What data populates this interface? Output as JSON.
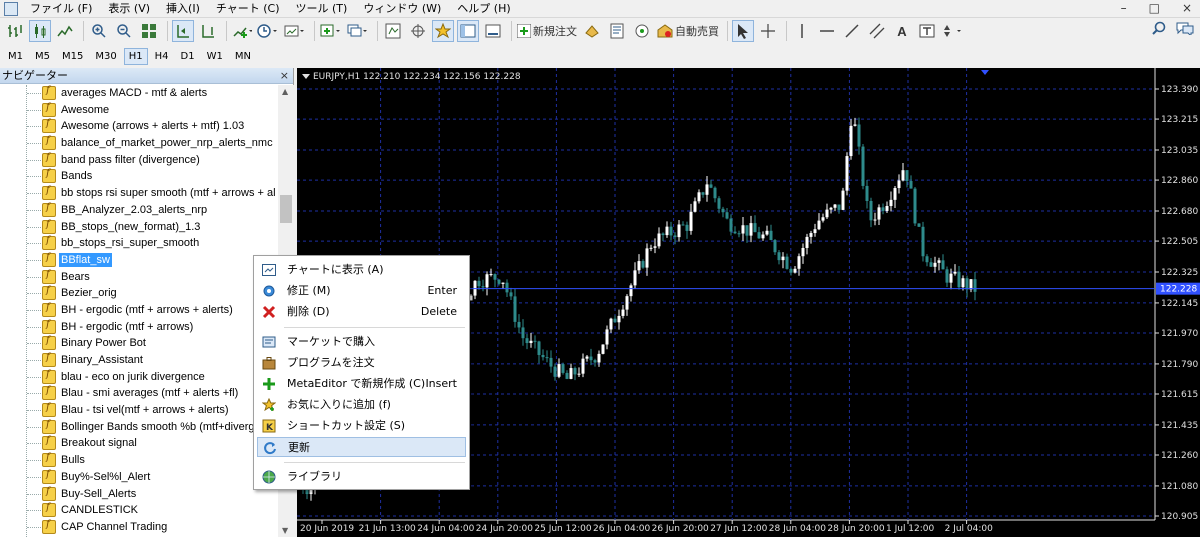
{
  "menubar": {
    "items": [
      "ファイル (F)",
      "表示 (V)",
      "挿入(I)",
      "チャート (C)",
      "ツール (T)",
      "ウィンドウ (W)",
      "ヘルプ (H)"
    ],
    "window_controls": [
      "–",
      "□",
      "×"
    ]
  },
  "toolbar": {
    "new_order_label": "新規注文",
    "auto_trade_label": "自動売買",
    "text_tool_label": "A"
  },
  "timeframes": [
    "M1",
    "M5",
    "M15",
    "M30",
    "H1",
    "H4",
    "D1",
    "W1",
    "MN"
  ],
  "active_timeframe": "H1",
  "navigator": {
    "title": "ナビゲーター",
    "close": "×",
    "items": [
      "averages MACD - mtf & alerts",
      "Awesome",
      "Awesome (arrows + alerts + mtf) 1.03",
      "balance_of_market_power_nrp_alerts_nmc",
      "band pass filter (divergence)",
      "Bands",
      "bb stops rsi super smooth (mtf + arrows + al",
      "BB_Analyzer_2.03_alerts_nrp",
      "BB_stops_(new_format)_1.3",
      "bb_stops_rsi_super_smooth",
      "BBflat_sw",
      "Bears",
      "Bezier_orig",
      "BH - ergodic (mtf + arrows + alerts)",
      "BH - ergodic (mtf + arrows)",
      "Binary Power Bot",
      "Binary_Assistant",
      "blau - eco on jurik divergence",
      "Blau - smi averages (mtf + alerts +fl)",
      "Blau - tsi vel(mtf + arrows + alerts)",
      "Bollinger Bands smooth %b (mtf+diverg",
      "Breakout signal",
      "Bulls",
      "Buy%-Sel%l_Alert",
      "Buy-Sell_Alerts",
      "CANDLESTICK",
      "CAP Channel Trading"
    ],
    "selected_index": 10
  },
  "chart": {
    "title": "EURJPY,H1  122.210 122.234 122.156 122.228",
    "price_labels": [
      "123.390",
      "123.215",
      "123.035",
      "122.860",
      "122.680",
      "122.505",
      "122.325",
      "122.145",
      "121.970",
      "121.790",
      "121.615",
      "121.435",
      "121.260",
      "121.080",
      "120.905"
    ],
    "current_price": "122.228",
    "time_labels": [
      "20 Jun 2019",
      "21 Jun 13:00",
      "24 Jun 04:00",
      "24 Jun 20:00",
      "25 Jun 12:00",
      "26 Jun 04:00",
      "26 Jun 20:00",
      "27 Jun 12:00",
      "28 Jun 04:00",
      "28 Jun 20:00",
      "1 Jul 12:00",
      "2 Jul 04:00"
    ],
    "colors": {
      "background": "#000000",
      "grid": "#1e2fa3",
      "bull_candle": "#ffffff",
      "bear_candle": "#2e8b8b",
      "price_line": "#3050ff",
      "current_price_bg": "#3050ff"
    }
  },
  "context_menu": {
    "items": [
      {
        "label": "チャートに表示 (A)",
        "shortcut": "",
        "icon": "chart-show-icon"
      },
      {
        "label": "修正 (M)",
        "shortcut": "Enter",
        "icon": "gear-icon"
      },
      {
        "label": "削除 (D)",
        "shortcut": "Delete",
        "icon": "delete-icon"
      },
      {
        "label": "マーケットで購入",
        "shortcut": "",
        "icon": "market-icon"
      },
      {
        "label": "プログラムを注文",
        "shortcut": "",
        "icon": "briefcase-icon"
      },
      {
        "label": "MetaEditor で新規作成 (C)",
        "shortcut": "Insert",
        "icon": "plus-icon"
      },
      {
        "label": "お気に入りに追加 (f)",
        "shortcut": "",
        "icon": "star-icon"
      },
      {
        "label": "ショートカット設定 (S)",
        "shortcut": "",
        "icon": "key-icon"
      },
      {
        "label": "更新",
        "shortcut": "",
        "icon": "refresh-icon"
      },
      {
        "label": "ライブラリ",
        "shortcut": "",
        "icon": "globe-icon"
      }
    ],
    "highlighted_index": 8
  }
}
